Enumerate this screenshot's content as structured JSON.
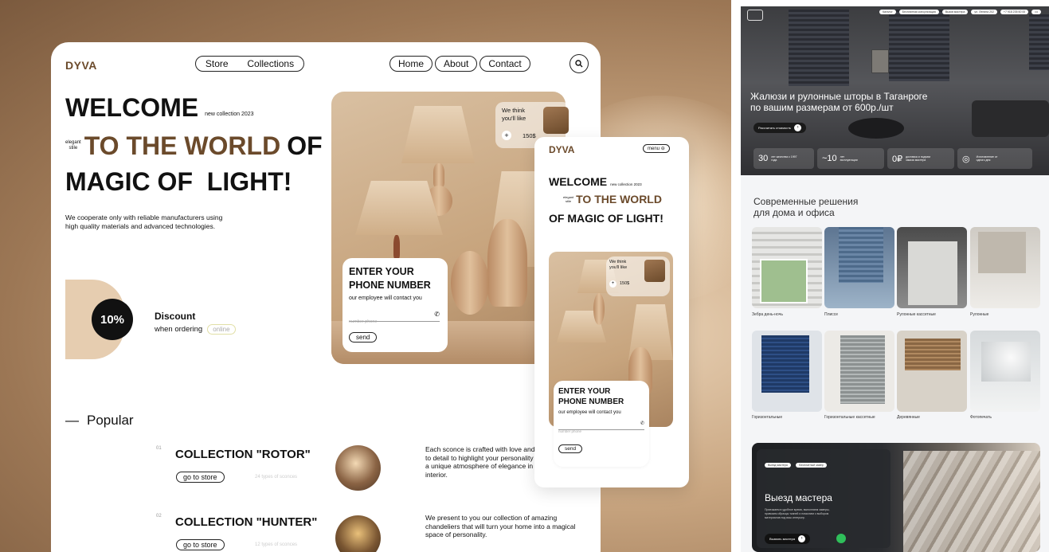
{
  "left": {
    "brand": "DYVA",
    "nav_center": [
      "Store",
      "Collections"
    ],
    "nav_right": [
      "Home",
      "About",
      "Contact"
    ],
    "hero": {
      "welcome": "WELCOME",
      "new_collection": "new collection 2023",
      "elegant": "elegant",
      "stile": "stile",
      "to_the_world": "TO THE WORLD",
      "of": "OF",
      "line3": "MAGIC OF  LIGHT!",
      "desc": "We cooperate only with reliable manufacturers using high quality materials and advanced technologies."
    },
    "discount": {
      "badge": "10%",
      "title": "Discount",
      "sub": "when ordering",
      "tag": "online"
    },
    "popular": {
      "dash": "—",
      "title": "Popular",
      "items": [
        {
          "num": "01",
          "name": "COLLECTION \"ROTOR\"",
          "button": "go to store",
          "count": "24 types of sconces",
          "desc": "Each sconce is crafted with love and attention to detail to highlight your personality and create a unique atmosphere of elegance in your interior."
        },
        {
          "num": "02",
          "name": "COLLECTION \"HUNTER\"",
          "button": "go to store",
          "count": "12 types of sconces",
          "desc": "We present to you our collection of amazing chandeliers that will turn your home into a magical space of personality."
        }
      ]
    },
    "think_card": {
      "line1": "We think",
      "line2": "you'll like",
      "plus": "+",
      "price": "150$"
    },
    "form": {
      "title1": "ENTER YOUR",
      "title2": "PHONE NUMBER",
      "sub": "our employee will contact you",
      "placeholder": "number phone",
      "button": "send"
    },
    "mobile": {
      "brand": "DYVA",
      "menu": "menu",
      "welcome": "WELCOME",
      "new_collection": "new collection 2023",
      "elegant": "elegant",
      "stile": "stile",
      "to_the_world": "TO THE WORLD",
      "line3": "OF MAGIC OF LIGHT!",
      "think_line1": "We think",
      "think_line2": "you'll like",
      "plus": "+",
      "price": "150$",
      "form_title1": "ENTER YOUR",
      "form_title2": "PHONE NUMBER",
      "form_sub": "our employee will contact you",
      "placeholder": "number phone",
      "button": "send"
    }
  },
  "right": {
    "top_pills": [
      "Каталог",
      "Бесплатная консультация",
      "Вызов мастера",
      "ул. Ленина 202",
      "+7 918 235 60 00",
      "•••"
    ],
    "hero_title1": "Жалюзи и рулонные шторы в Таганроге",
    "hero_title2": "по вашим размерам от 600р./шт",
    "hero_button": "Рассчитать стоимость",
    "stats": [
      {
        "value": "30",
        "label": "лет качества с 1997 года"
      },
      {
        "value": "~10",
        "label": "лет эксплуатации"
      },
      {
        "value": "0₽",
        "label": "доставка и подъем заказа мастера"
      },
      {
        "value": "◎",
        "label": "Изготовление от одного дня"
      }
    ],
    "section_title1": "Современные решения",
    "section_title2": "для дома и офиса",
    "tiles": [
      {
        "label": "Зебра день-ночь"
      },
      {
        "label": "Плиссе"
      },
      {
        "label": "Рулонные кассетные"
      },
      {
        "label": "Рулонные"
      },
      {
        "label": "Горизонтальные"
      },
      {
        "label": "Горизонтальные кассетные"
      },
      {
        "label": "Деревянные"
      },
      {
        "label": "Фотопечать"
      }
    ],
    "master": {
      "tags": [
        "Выезд мастера",
        "Бесплатный замер"
      ],
      "title": "Выезд мастера",
      "desc": "Приезжаем в удобное время, выполняем замеры, привозим образцы тканей и помогаем с выбором материалов под ваш интерьер.",
      "button": "Вызвать мастера"
    }
  },
  "colors": {
    "accent": "#6b4a2b",
    "beige": "#e6cdb0",
    "dark": "#111111"
  }
}
